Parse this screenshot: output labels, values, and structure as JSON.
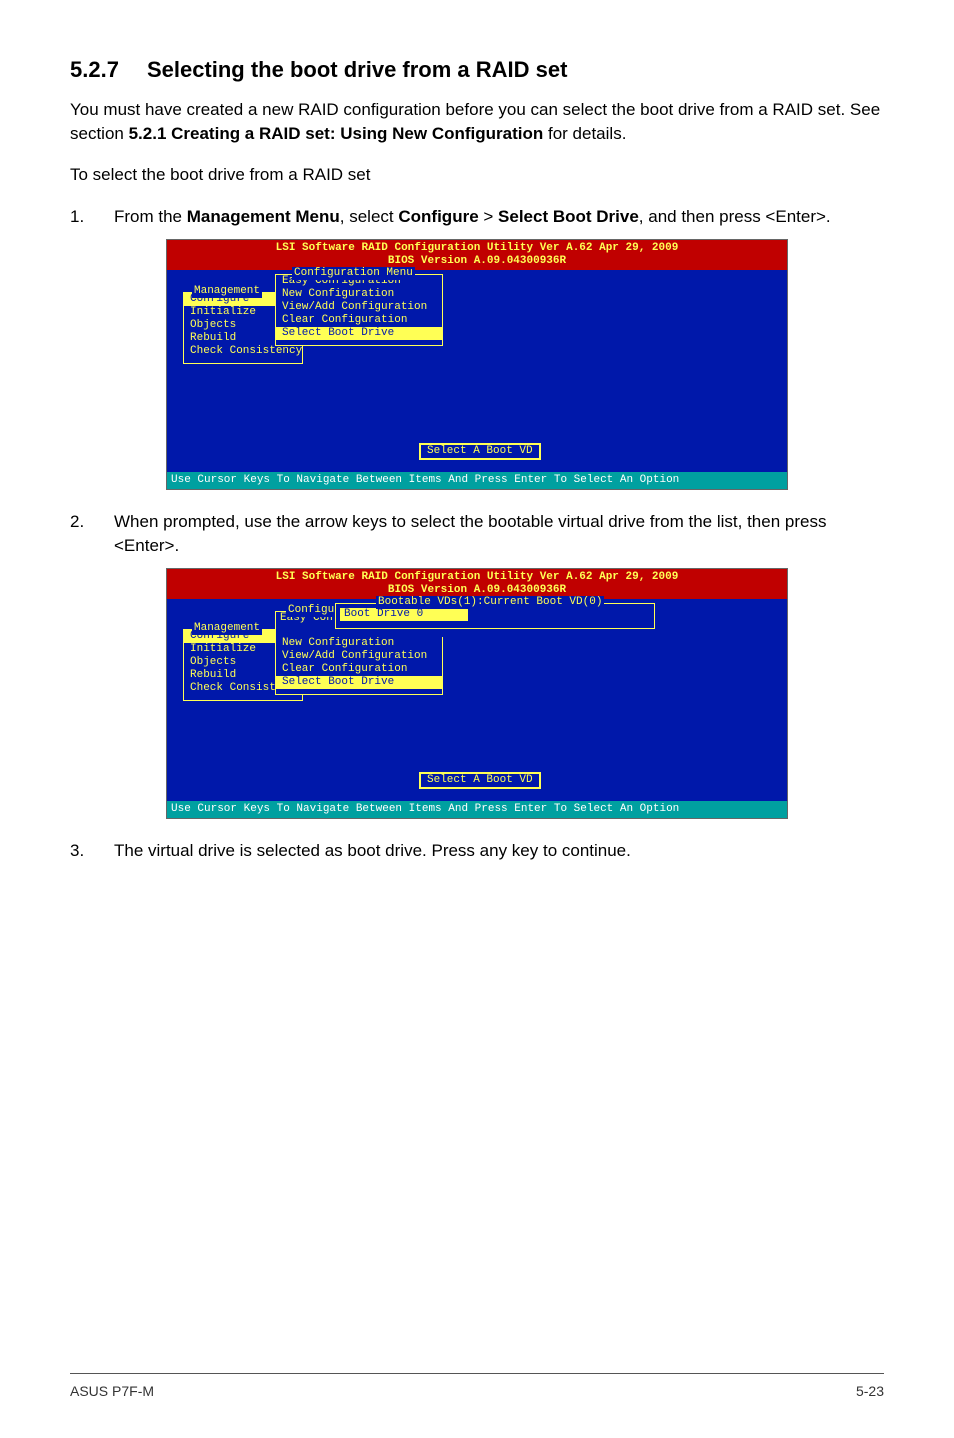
{
  "heading": {
    "number": "5.2.7",
    "title": "Selecting the boot drive from a RAID set"
  },
  "intro_parts": {
    "p1_a": "You must have created a new RAID configuration before you can select the boot drive from a RAID set. See section ",
    "p1_b": "5.2.1 Creating a RAID set: Using New Configuration",
    "p1_c": " for details.",
    "p2": "To select the boot drive from a RAID set"
  },
  "steps": {
    "s1": {
      "num": "1.",
      "a": "From the ",
      "b": "Management Menu",
      "c": ", select ",
      "d": "Configure",
      "e": " > ",
      "f": "Select Boot Drive",
      "g": ", and then press <Enter>."
    },
    "s2": {
      "num": "2.",
      "text": "When prompted, use the arrow keys to select the bootable virtual drive from the list, then press <Enter>."
    },
    "s3": {
      "num": "3.",
      "text": "The virtual drive is selected as boot drive. Press any key to continue."
    }
  },
  "bios": {
    "header_l1": "LSI Software RAID Configuration Utility Ver A.62 Apr 29, 2009",
    "header_l2": "BIOS Version   A.09.04300936R",
    "mgmt_label": "Management",
    "mgmt_items": [
      "Configure",
      "Initialize",
      "Objects",
      "Rebuild",
      "Check Consistency"
    ],
    "cfg_label": "Configuration Menu",
    "cfg_items": [
      "Easy Configuration",
      "New Configuration",
      "View/Add Configuration",
      "Clear Configuration",
      "Select Boot Drive"
    ],
    "cfg_label_trunc": "Configu",
    "cfg_below_trunc": "Easy Con",
    "bootable_label": "Bootable VDs(1):Current Boot VD(0)",
    "bootable_item": "Boot Drive 0",
    "status": "Select A Boot VD",
    "footer": "Use Cursor Keys To Navigate Between Items And Press Enter To Select An Option"
  },
  "page_footer": {
    "left": "ASUS P7F-M",
    "right": "5-23"
  }
}
